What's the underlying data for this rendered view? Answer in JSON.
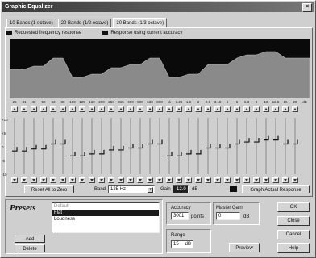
{
  "window": {
    "title": "Graphic Equalizer",
    "close_glyph": "×"
  },
  "tabs": [
    {
      "label": "10 Bands (1 octave)",
      "active": false
    },
    {
      "label": "20 Bands (1/2 octave)",
      "active": false
    },
    {
      "label": "30 Bands (1/3 octave)",
      "active": true
    }
  ],
  "legend": {
    "requested": "Requested frequency response",
    "current": "Response using current accuracy"
  },
  "frequencies": [
    "25",
    "31",
    "40",
    "50",
    "63",
    "80",
    "100",
    "125",
    "160",
    "200",
    "250",
    "315",
    "400",
    "500",
    "630",
    "800",
    "1k",
    "1.25",
    "1.6",
    "2",
    "2.5",
    "3.15",
    "4",
    "5",
    "6.3",
    "8",
    "10",
    "12.5",
    "16",
    "20",
    "dB"
  ],
  "scale": [
    "+10",
    "+5",
    "0",
    "-5",
    "-10"
  ],
  "band_levels_db": [
    -2.5,
    -2.5,
    -1.5,
    -1.5,
    1,
    1,
    -5,
    -5,
    -4,
    -4,
    -2,
    -2,
    -1,
    -1,
    1,
    1,
    -5,
    -5,
    -4,
    -4,
    -1,
    -1,
    -1,
    1,
    2,
    2,
    3,
    3,
    1,
    1
  ],
  "controls": {
    "reset_label": "Reset All to Zero",
    "band_label": "Band",
    "band_value": "125 Hz",
    "gain_label": "Gain",
    "gain_value": "-12.0",
    "gain_unit": "dB",
    "graph_label": "Graph Actual Response"
  },
  "presets": {
    "title": "Presets",
    "items": [
      {
        "label": "Default",
        "state": "dim"
      },
      {
        "label": "Flat",
        "state": "selected"
      },
      {
        "label": "Loudness",
        "state": "normal"
      }
    ],
    "add_label": "Add",
    "delete_label": "Delete"
  },
  "accuracy": {
    "label": "Accuracy",
    "value": "3001",
    "unit": "points"
  },
  "master_gain": {
    "label": "Master Gain",
    "value": "0",
    "unit": "dB"
  },
  "range": {
    "label": "Range",
    "value": "15",
    "unit": "dB"
  },
  "buttons": {
    "ok": "OK",
    "close": "Close",
    "cancel": "Cancel",
    "preview": "Preview",
    "help": "Help"
  },
  "colors": {
    "plot_bg": "#0a0a0a",
    "curve_fill": "#8a8a8a",
    "selection": "#1a1a1a"
  }
}
